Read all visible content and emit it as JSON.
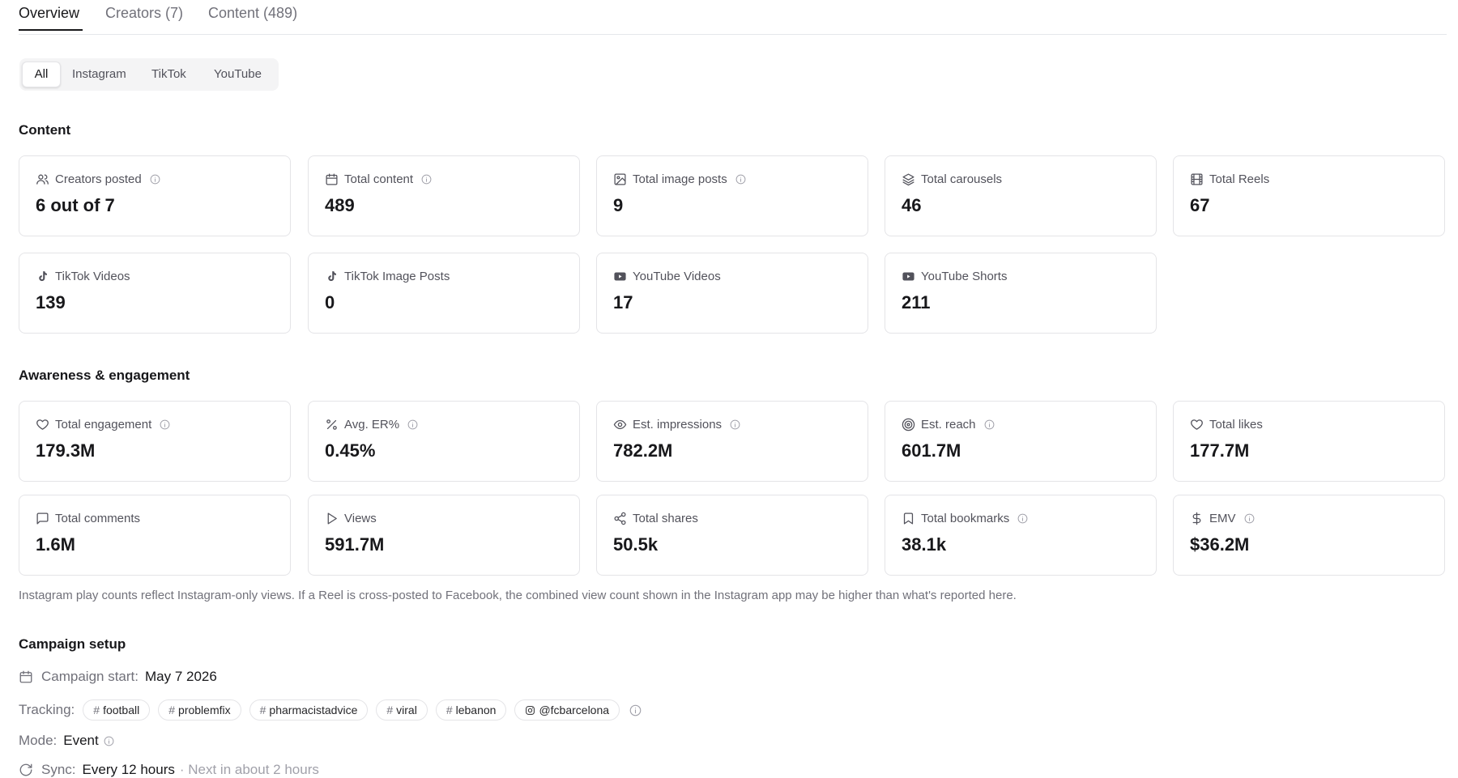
{
  "tabs": {
    "overview": "Overview",
    "creators": "Creators (7)",
    "content": "Content (489)"
  },
  "platform_filter": {
    "all": "All",
    "instagram": "Instagram",
    "tiktok": "TikTok",
    "youtube": "YouTube"
  },
  "content_section": {
    "title": "Content",
    "cards": {
      "creators_posted": {
        "label": "Creators posted",
        "value": "6 out of 7"
      },
      "total_content": {
        "label": "Total content",
        "value": "489"
      },
      "total_image_posts": {
        "label": "Total image posts",
        "value": "9"
      },
      "total_carousels": {
        "label": "Total carousels",
        "value": "46"
      },
      "total_reels": {
        "label": "Total Reels",
        "value": "67"
      },
      "tiktok_videos": {
        "label": "TikTok Videos",
        "value": "139"
      },
      "tiktok_image_posts": {
        "label": "TikTok Image Posts",
        "value": "0"
      },
      "youtube_videos": {
        "label": "YouTube Videos",
        "value": "17"
      },
      "youtube_shorts": {
        "label": "YouTube Shorts",
        "value": "211"
      }
    }
  },
  "engagement_section": {
    "title": "Awareness & engagement",
    "cards": {
      "total_engagement": {
        "label": "Total engagement",
        "value": "179.3M"
      },
      "avg_er": {
        "label": "Avg. ER%",
        "value": "0.45%"
      },
      "est_impressions": {
        "label": "Est. impressions",
        "value": "782.2M"
      },
      "est_reach": {
        "label": "Est. reach",
        "value": "601.7M"
      },
      "total_likes": {
        "label": "Total likes",
        "value": "177.7M"
      },
      "total_comments": {
        "label": "Total comments",
        "value": "1.6M"
      },
      "views": {
        "label": "Views",
        "value": "591.7M"
      },
      "total_shares": {
        "label": "Total shares",
        "value": "50.5k"
      },
      "total_bookmarks": {
        "label": "Total bookmarks",
        "value": "38.1k"
      },
      "emv": {
        "label": "EMV",
        "value": "$36.2M"
      }
    },
    "note": "Instagram play counts reflect Instagram-only views. If a Reel is cross-posted to Facebook, the combined view count shown in the Instagram app may be higher than what's reported here."
  },
  "campaign_setup": {
    "title": "Campaign setup",
    "start_label": "Campaign start:",
    "start_value": "May 7 2026",
    "tracking_label": "Tracking:",
    "tracking": [
      "football",
      "problemfix",
      "pharmacistadvice",
      "viral",
      "lebanon"
    ],
    "tracking_account": "@fcbarcelona",
    "mode_label": "Mode:",
    "mode_value": "Event",
    "sync_label": "Sync:",
    "sync_value": "Every 12 hours",
    "sync_next": "· Next in about 2 hours"
  }
}
